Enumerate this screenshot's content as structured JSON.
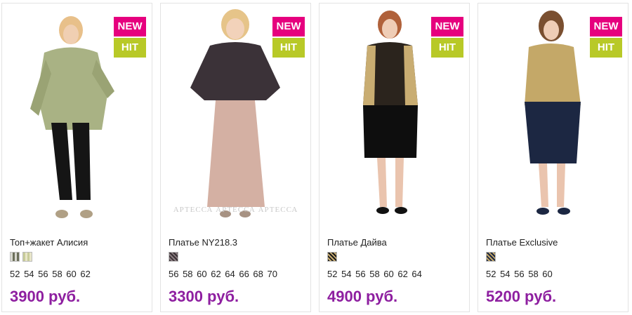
{
  "badges": {
    "new": "NEW",
    "hit": "HIT"
  },
  "colors": {
    "new_badge": "#e6007e",
    "hit_badge": "#b8c927",
    "price": "#8e1fa0"
  },
  "products": [
    {
      "name": "Топ+жакет Алисия",
      "sizes": "52 54 56 58 60 62",
      "price": "3900 руб.",
      "swatch_count": 2
    },
    {
      "name": "Платье NY218.3",
      "sizes": "56 58 60 62 64 66 68 70",
      "price": "3300 руб.",
      "swatch_count": 1,
      "watermark": "АРТЕССА  АРТЕССА  АРТЕССА"
    },
    {
      "name": "Платье Дайва",
      "sizes": "52 54 56 58 60 62 64",
      "price": "4900 руб.",
      "swatch_count": 1
    },
    {
      "name": "Платье Exclusive",
      "sizes": "52 54 56 58 60",
      "price": "5200 руб.",
      "swatch_count": 1
    }
  ]
}
